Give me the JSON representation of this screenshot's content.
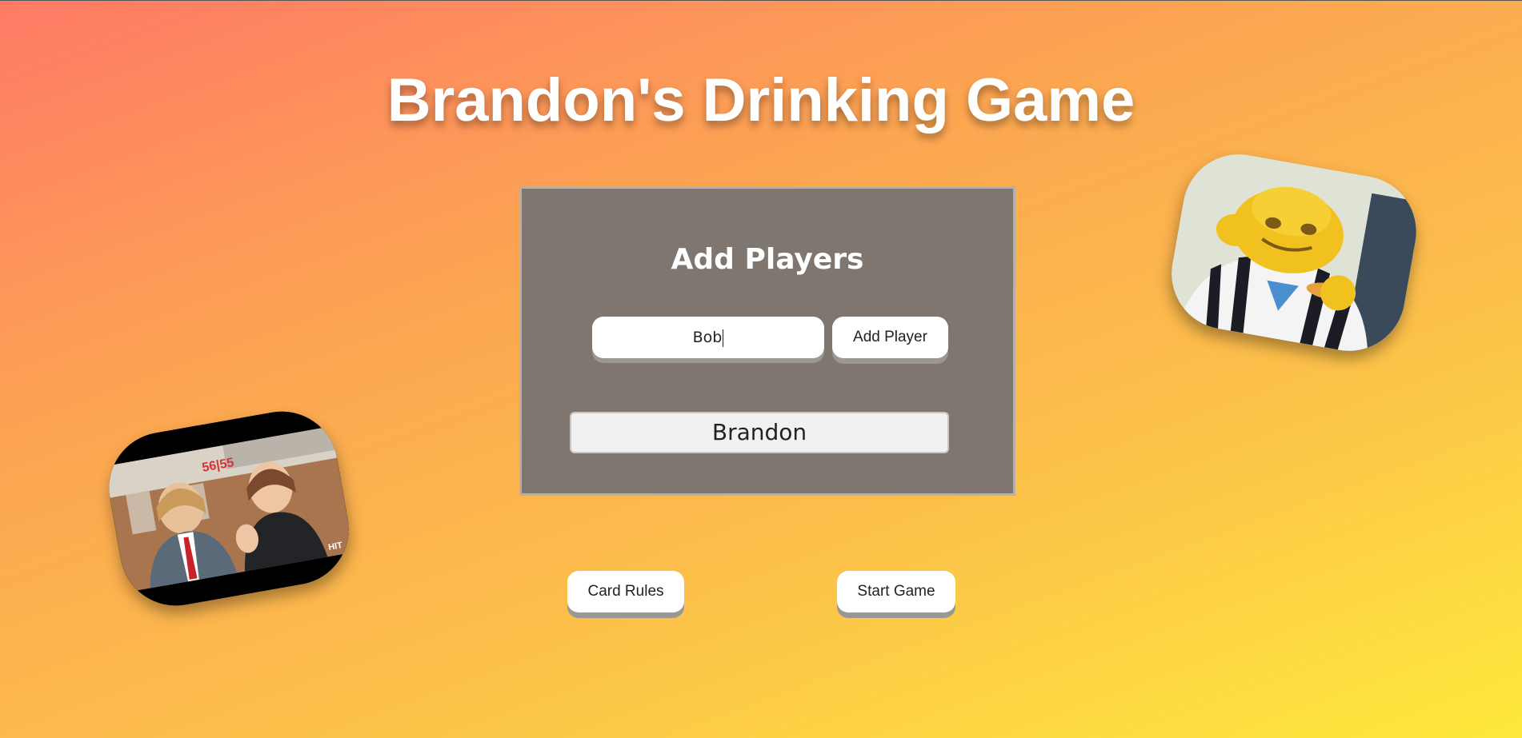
{
  "page": {
    "title": "Brandon's Drinking Game"
  },
  "add_players_panel": {
    "heading": "Add Players",
    "name_input_value": "Bob",
    "add_button_label": "Add Player",
    "players": [
      "Brandon"
    ]
  },
  "actions": {
    "card_rules_label": "Card Rules",
    "start_game_label": "Start Game"
  },
  "photos": {
    "left_sign_text": "56|55",
    "left_corner_text": "HIT"
  },
  "colors": {
    "gradient_start": "#ff7a66",
    "gradient_end": "#fee93c",
    "panel_bg": "#7e766f",
    "button_bg": "#ffffff",
    "button_shadow": "#9b9894"
  }
}
